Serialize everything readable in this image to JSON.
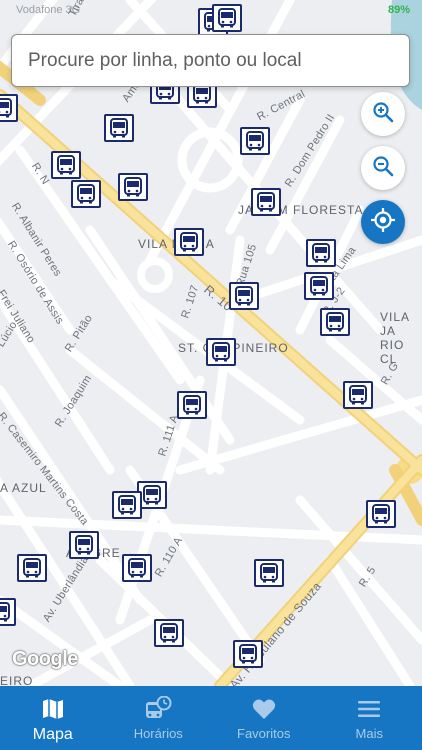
{
  "status_bar": {
    "carrier": "Vodafone 3G",
    "battery": "89%"
  },
  "search": {
    "placeholder": "Procure por linha, ponto ou local"
  },
  "map_labels": {
    "jardim_floresta": "JARDIM FLORESTA",
    "vila_maria": "VILA MARIA",
    "st_campineiro": "ST. CAMPINEIRO",
    "vila_rio_cl": "VILA JA RIO CL",
    "azul": "A AZUL",
    "alegre": "ALEGRE",
    "eiro": "EIRO",
    "r_central": "R. Central",
    "r_dom_pedro": "R. Dom Pedro II",
    "r_albanir_peres": "R. Albanir Peres",
    "r_osorio_de_assis": "R. Osório de Assis",
    "frei_juliano": "Frei Juliano",
    "lucio": "Lúcio",
    "r_pitao": "R. Pitão",
    "r_joaquim": "R. Joaquim",
    "r_casemiro": "R. Casemiro Martins Costa",
    "r_111a": "R. 111 A",
    "r_107": "R. 107",
    "rua_105": "Rua 105",
    "r_10": "R. 10",
    "r_g": "R. G",
    "r_110a": "R. 110 A",
    "av_uberlandia": "Av. Uberlândia",
    "av_herculano": "Av. Herculano de Souza",
    "r_5": "R. 5",
    "costa_lima": "Costa Lima",
    "r_j2": "R. J-2",
    "americas": "Américas",
    "tiradentes": "Tiradentes",
    "r_n": "R. N"
  },
  "google_logo": "Google",
  "tabs": [
    {
      "label": "Mapa",
      "icon": "map-icon",
      "active": true
    },
    {
      "label": "Horários",
      "icon": "bus-clock-icon",
      "active": false
    },
    {
      "label": "Favoritos",
      "icon": "heart-icon",
      "active": false
    },
    {
      "label": "Mais",
      "icon": "menu-icon",
      "active": false
    }
  ],
  "colors": {
    "accent": "#1676c4",
    "bus_border": "#1a2a6c",
    "main_road": "#f7dc84"
  }
}
